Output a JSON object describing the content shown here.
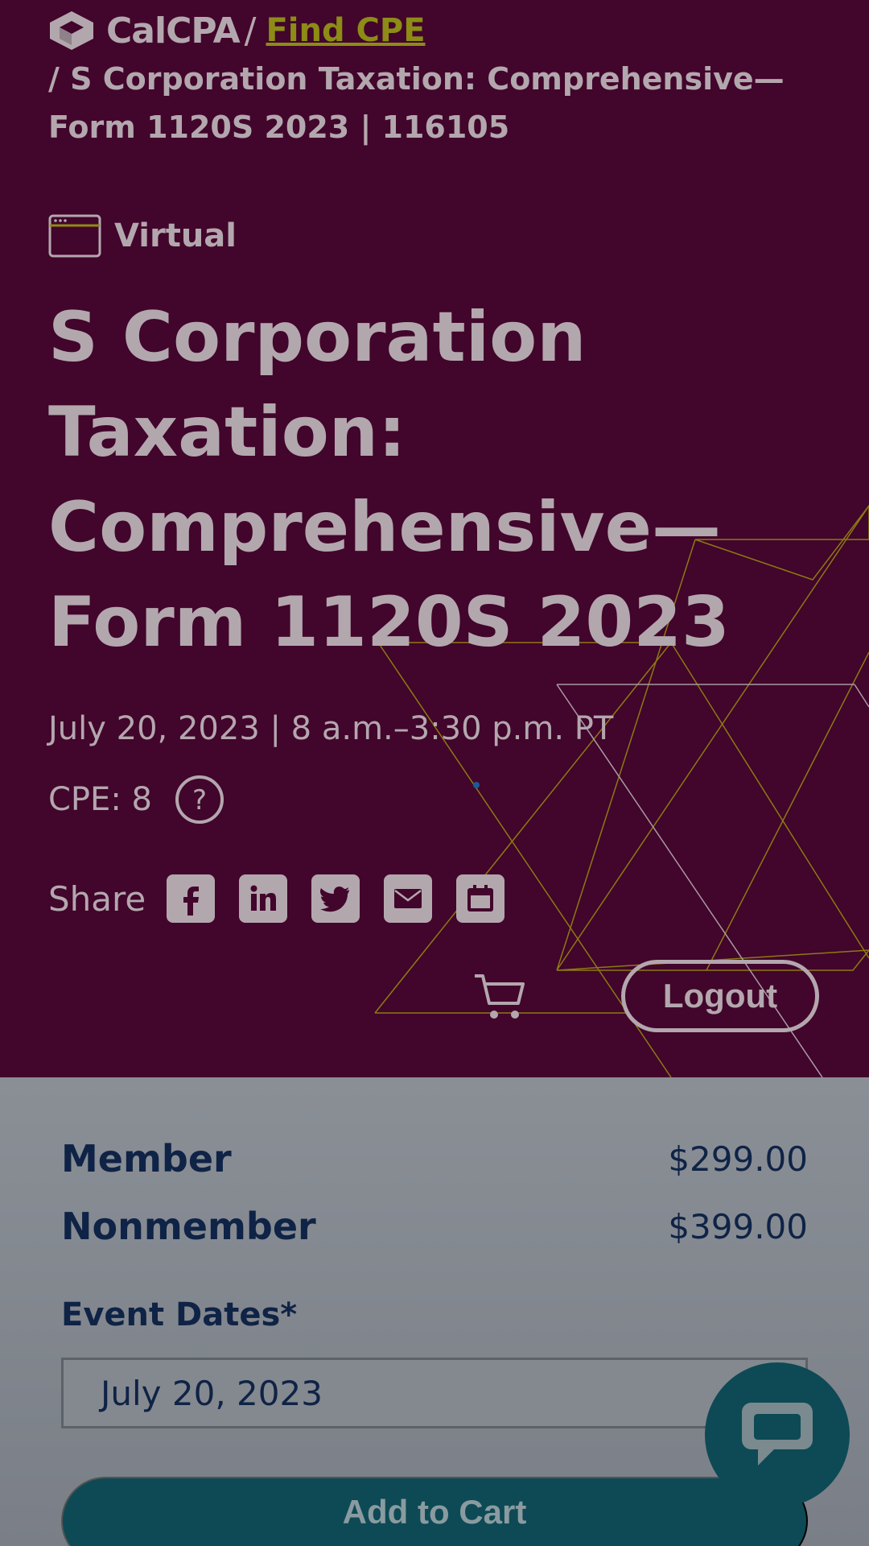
{
  "colors": {
    "hero_bg": "#42052b",
    "hero_text": "#b3a7ae",
    "link": "#8c8c16",
    "navy_text": "#0f2346",
    "teal": "#0d4a55"
  },
  "breadcrumb": {
    "logo": "CalCPA",
    "separator": "/",
    "link": "Find CPE",
    "current": "/ S Corporation Taxation: Comprehensive—Form 1120S 2023 | 116105"
  },
  "event": {
    "format": "Virtual",
    "title": "S Corporation Taxation: Comprehensive—Form 1120S 2023",
    "datetime": "July 20, 2023 | 8 a.m.–3:30 p.m. PT",
    "cpe": "CPE: 8"
  },
  "share": {
    "label": "Share",
    "icons": [
      "facebook-icon",
      "linkedin-icon",
      "twitter-icon",
      "email-icon",
      "calendar-icon"
    ]
  },
  "header_actions": {
    "logout": "Logout"
  },
  "pricing": {
    "member_label": "Member",
    "member_price": "$299.00",
    "nonmember_label": "Nonmember",
    "nonmember_price": "$399.00"
  },
  "dates": {
    "label": "Event Dates*",
    "selected": "July 20, 2023"
  },
  "cta": {
    "add_to_cart": "Add to Cart"
  }
}
